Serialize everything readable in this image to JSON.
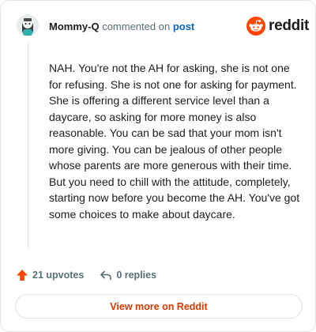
{
  "header": {
    "username": "Mommy-Q",
    "commented_text": "commented on",
    "post_link": "post",
    "brand": "reddit"
  },
  "comment": {
    "body": "NAH. You're not the AH for asking, she is not one for refusing. She is not one for asking for payment. She is offering a different service level than a daycare, so asking for more money is also reasonable. You can be sad that your mom isn't more giving. You can be jealous of other people whose parents are more generous with their time. But you need to chill with the attitude, completely, starting now before you become the AH. You've got some choices to make about daycare."
  },
  "actions": {
    "upvotes": "21 upvotes",
    "replies": "0 replies"
  },
  "footer": {
    "view_more": "View more on Reddit"
  },
  "icons": {
    "upvote": "upvote-arrow-icon",
    "reply": "reply-arrow-icon",
    "brand": "reddit-snoo-icon"
  },
  "colors": {
    "accent": "#d93900",
    "link": "#0a66c2",
    "upvote": "#ff4500",
    "muted": "#576f76"
  }
}
